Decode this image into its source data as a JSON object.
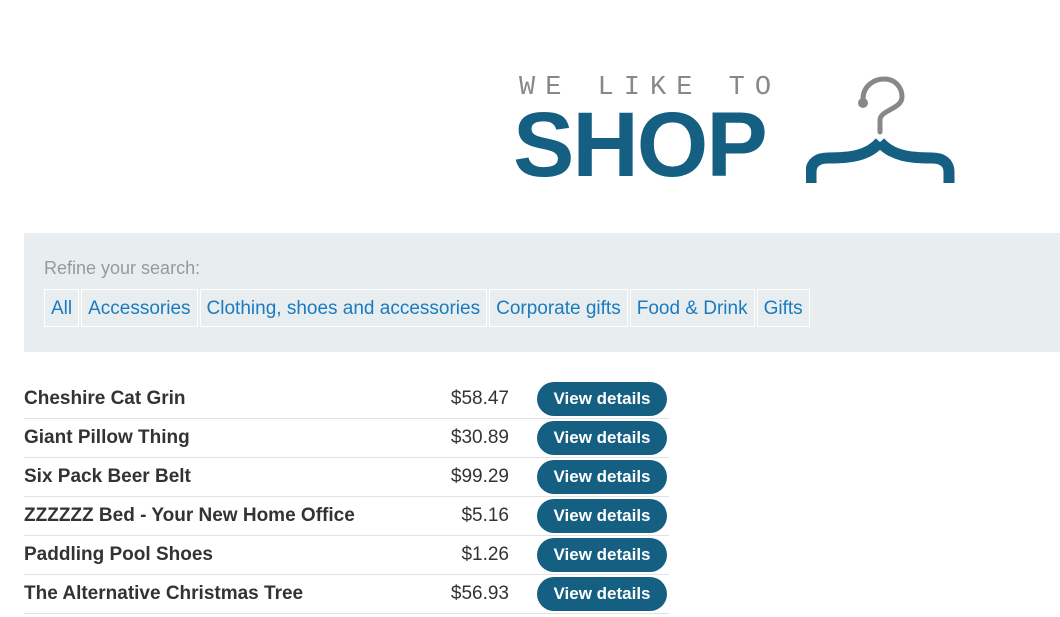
{
  "logo": {
    "tagline": "WE LIKE TO",
    "word": "SHOP",
    "icon": "hanger-icon",
    "colors": {
      "tagline": "#888888",
      "word": "#155f82",
      "hanger_hook": "#888888",
      "hanger_body": "#155f82"
    }
  },
  "filters": {
    "label": "Refine your search:",
    "items": [
      {
        "label": "All"
      },
      {
        "label": "Accessories"
      },
      {
        "label": "Clothing, shoes and accessories"
      },
      {
        "label": "Corporate gifts"
      },
      {
        "label": "Food & Drink"
      },
      {
        "label": "Gifts"
      }
    ],
    "colors": {
      "panel_background": "#e8edf0",
      "link": "#1b7bbf"
    }
  },
  "products": [
    {
      "name": "Cheshire Cat Grin",
      "price": "$58.47",
      "button": "View details"
    },
    {
      "name": "Giant Pillow Thing",
      "price": "$30.89",
      "button": "View details"
    },
    {
      "name": "Six Pack Beer Belt",
      "price": "$99.29",
      "button": "View details"
    },
    {
      "name": "ZZZZZZ Bed - Your New Home Office",
      "price": "$5.16",
      "button": "View details"
    },
    {
      "name": "Paddling Pool Shoes",
      "price": "$1.26",
      "button": "View details"
    },
    {
      "name": "The Alternative Christmas Tree",
      "price": "$56.93",
      "button": "View details"
    }
  ],
  "colors": {
    "button_background": "#155f82",
    "button_text": "#ffffff"
  }
}
